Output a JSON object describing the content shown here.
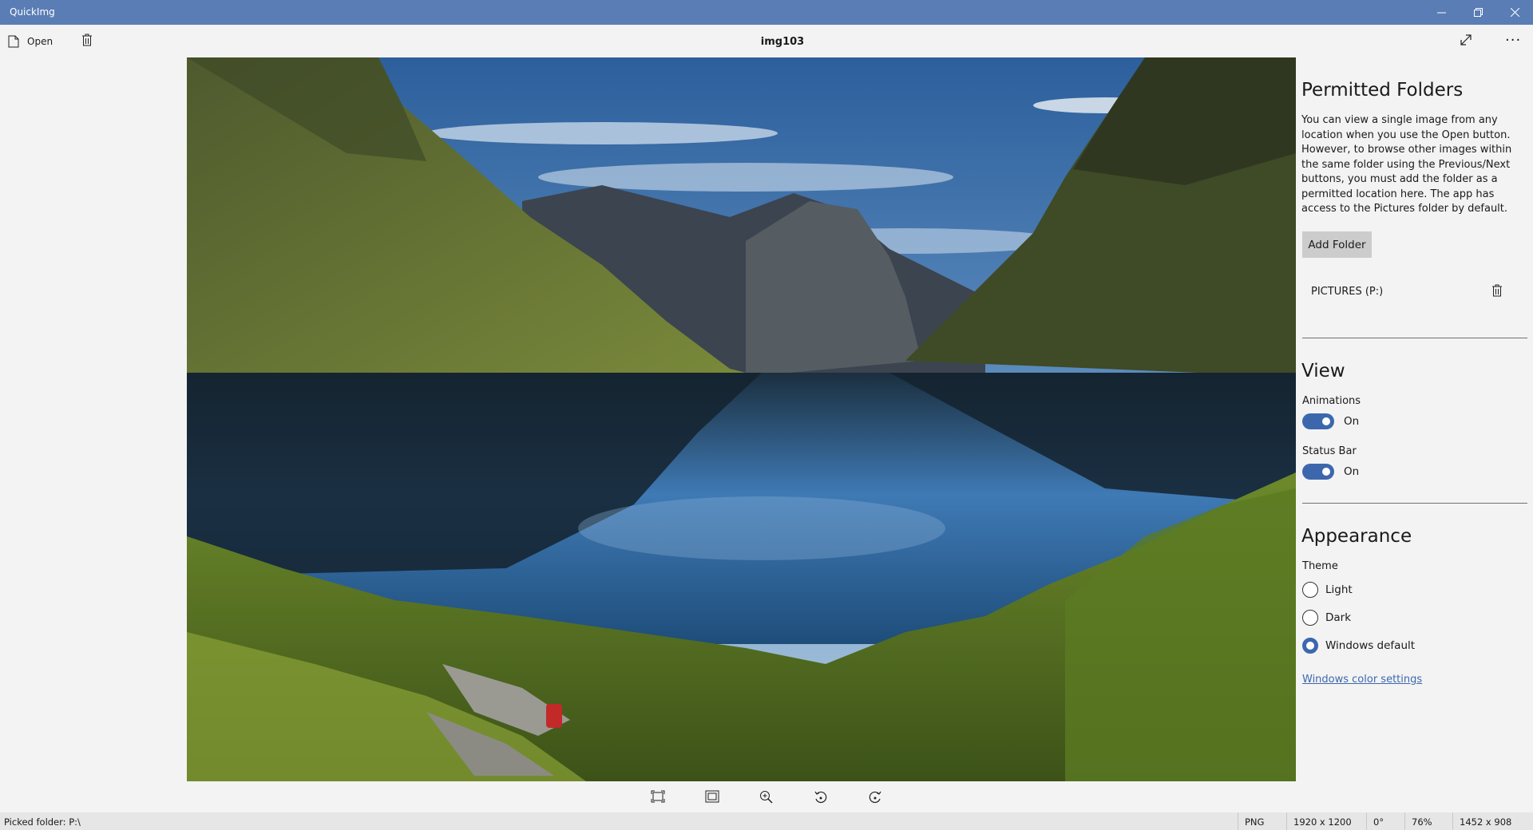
{
  "window": {
    "title": "QuickImg",
    "minimize_glyph": "–",
    "restore_glyph": "❐",
    "close_glyph": "✕"
  },
  "toolbar": {
    "open_label": "Open",
    "image_name": "img103",
    "more_glyph": "···"
  },
  "settings": {
    "permitted": {
      "title": "Permitted Folders",
      "description": "You can view a single image from any location when you use the Open button. However, to browse other images within the same folder using the Previous/Next buttons, you must add the folder as a permitted location here. The app has access to the Pictures folder by default.",
      "add_folder_label": "Add Folder",
      "folders": [
        "PICTURES (P:)"
      ]
    },
    "view": {
      "title": "View",
      "animations_label": "Animations",
      "animations_state": "On",
      "status_bar_label": "Status Bar",
      "status_bar_state": "On"
    },
    "appearance": {
      "title": "Appearance",
      "theme_label": "Theme",
      "options": [
        "Light",
        "Dark",
        "Windows default"
      ],
      "selected": "Windows default",
      "color_link": "Windows color settings"
    }
  },
  "status": {
    "picked_folder": "Picked folder: P:\\",
    "format": "PNG",
    "original_size": "1920 x 1200",
    "rotation": "0°",
    "zoom": "76%",
    "display_size": "1452 x 908"
  },
  "colors": {
    "titlebar": "#5a7db5",
    "accent": "#3d67ad"
  }
}
